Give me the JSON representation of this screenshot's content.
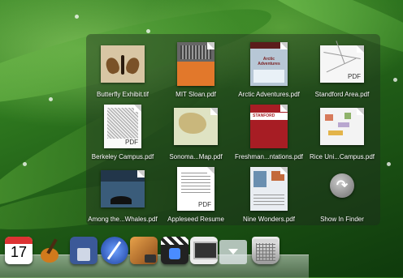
{
  "stack": {
    "items": [
      {
        "label": "Butterfly Exhibit.tif",
        "icon": "butterfly-image-icon"
      },
      {
        "label": "MIT Sloan.pdf",
        "icon": "pdf-document-icon"
      },
      {
        "label": "Arctic Adventures.pdf",
        "icon": "pdf-document-icon",
        "cover_title": "Arctic Adventures"
      },
      {
        "label": "Standford Area.pdf",
        "icon": "pdf-map-icon",
        "badge": "PDF"
      },
      {
        "label": "Berkeley Campus.pdf",
        "icon": "pdf-map-icon",
        "badge": "PDF"
      },
      {
        "label": "Sonoma...Map.pdf",
        "icon": "pdf-map-icon"
      },
      {
        "label": "Freshman...ntations.pdf",
        "icon": "pdf-document-icon",
        "cover_title": "STANFORD"
      },
      {
        "label": "Rice Uni...Campus.pdf",
        "icon": "pdf-map-icon"
      },
      {
        "label": "Among the...Whales.pdf",
        "icon": "pdf-document-icon"
      },
      {
        "label": "Appleseed Resume",
        "icon": "pdf-document-icon",
        "badge": "PDF"
      },
      {
        "label": "Nine Wonders.pdf",
        "icon": "pdf-document-icon"
      }
    ],
    "show_in_finder": {
      "label": "Show In Finder",
      "icon": "arrow-curve-icon"
    }
  },
  "dock": {
    "calendar_day": "17",
    "items": [
      "calendar-icon",
      "garageband-icon",
      "keynote-icon",
      "quill-icon",
      "photo-booth-icon",
      "clapper-icon",
      "screen-icon",
      "stack-icon",
      "trash-icon"
    ]
  }
}
